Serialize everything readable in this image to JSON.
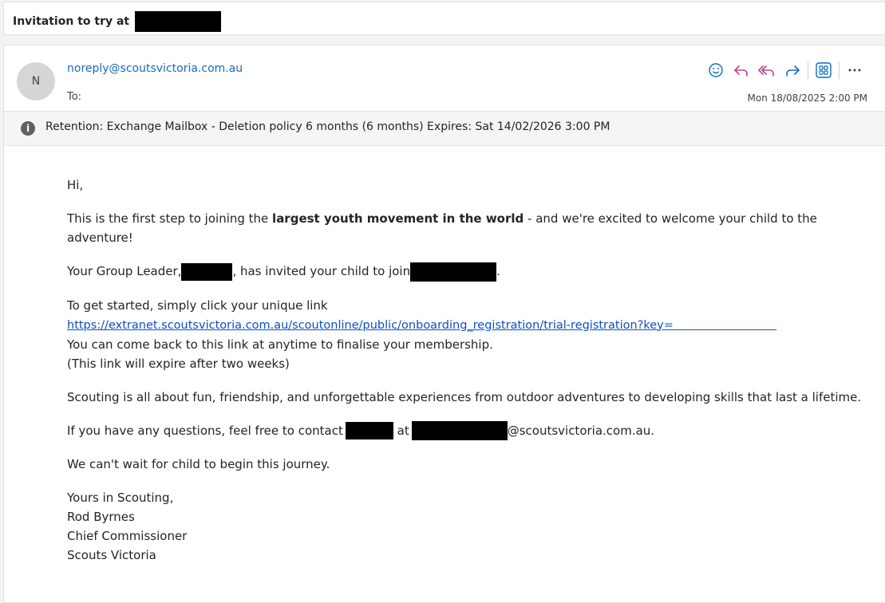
{
  "subject": "Invitation to try at",
  "sender": {
    "avatar_initial": "N",
    "email": "noreply@scoutsvictoria.com.au",
    "to_label": "To:",
    "date": "Mon 18/08/2025 2:00 PM"
  },
  "actions": [
    "smiley-icon",
    "reply-icon",
    "reply-all-icon",
    "forward-icon",
    "apps-icon",
    "more-icon"
  ],
  "retention": "Retention: Exchange Mailbox - Deletion policy 6 months (6 months) Expires: Sat 14/02/2026 3:00 PM",
  "body": {
    "greeting": "Hi,",
    "intro_before": "This is the first step to joining the ",
    "intro_bold": "largest youth movement in the world",
    "intro_after": " - and we're excited to welcome your child to the adventure!",
    "leader_a": "Your Group Leader,",
    "leader_b": ", has invited your child to join",
    "leader_c": ".",
    "started": "To get started, simply click your unique link",
    "link": "https://extranet.scoutsvictoria.com.au/scoutonline/public/onboarding_registration/trial-registration?key=",
    "comeback": "You can come back to this link at anytime to finalise your membership.",
    "expire": "(This link will expire after two weeks)",
    "scouting": "Scouting is all about fun, friendship, and unforgettable experiences from outdoor adventures to developing skills that last a lifetime.",
    "contact_a": "If you have any questions, feel free to contact",
    "contact_b": " at",
    "contact_c": "@scoutsvictoria.com.au.",
    "journey": "We can't wait for child to begin this journey.",
    "sign1": "Yours in Scouting,",
    "sign2": "Rod Byrnes",
    "sign3": "Chief Commissioner",
    "sign4": "Scouts Victoria"
  },
  "colors": {
    "link": "#0b4fc8",
    "sender": "#1a6bb7",
    "accent": "#0f6cbd"
  }
}
